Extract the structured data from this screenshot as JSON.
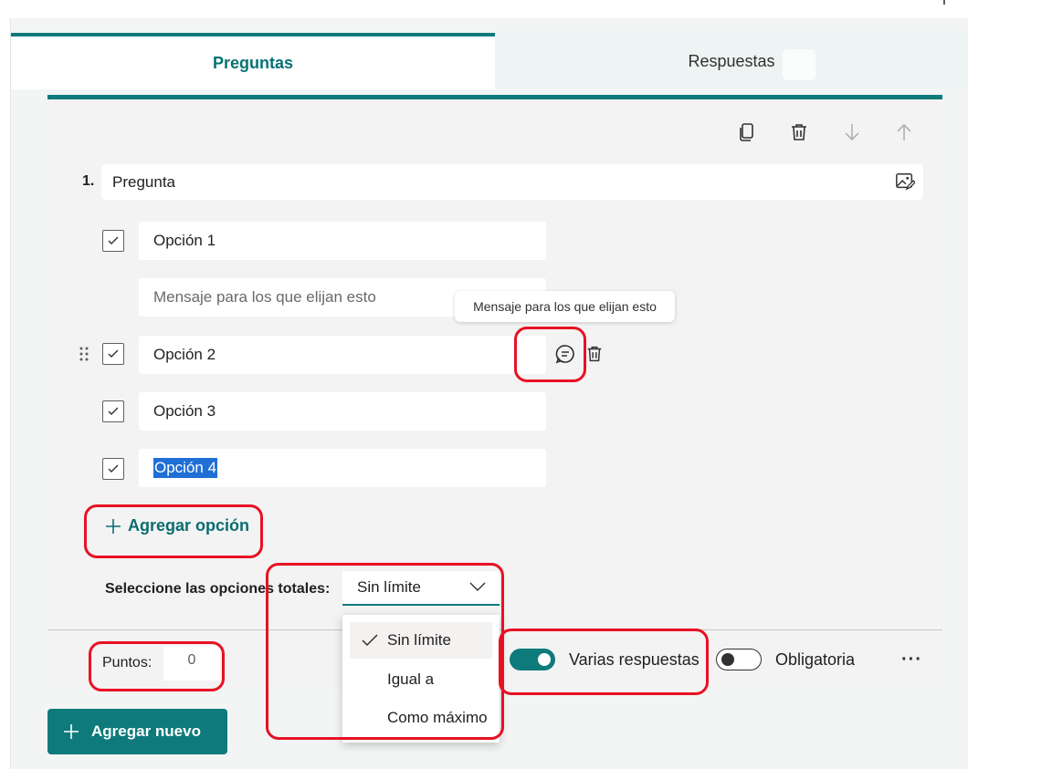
{
  "tabs": {
    "questions_label": "Preguntas",
    "responses_label": "Respuestas"
  },
  "question": {
    "number": "1.",
    "title": "Pregunta",
    "options": [
      {
        "label": "Opción 1"
      },
      {
        "label": "Opción 2"
      },
      {
        "label": "Opción 3"
      },
      {
        "label": "Opción 4"
      }
    ],
    "message_placeholder": "Mensaje para los que elijan esto",
    "tooltip": "Mensaje para los que elijan esto",
    "add_option": "Agregar opción",
    "select_total_label": "Seleccione las opciones totales:",
    "select_total_value": "Sin límite",
    "select_total_options": [
      "Sin límite",
      "Igual a",
      "Como máximo"
    ],
    "points_label": "Puntos:",
    "points_value": "0",
    "multiple_answers_label": "Varias respuestas",
    "multiple_answers_on": true,
    "required_label": "Obligatoria",
    "required_on": false
  },
  "footer": {
    "add_new_label": "Agregar nuevo"
  },
  "colors": {
    "accent": "#0e7a7b",
    "highlight": "#e81123",
    "selection": "#1f6fd6"
  }
}
